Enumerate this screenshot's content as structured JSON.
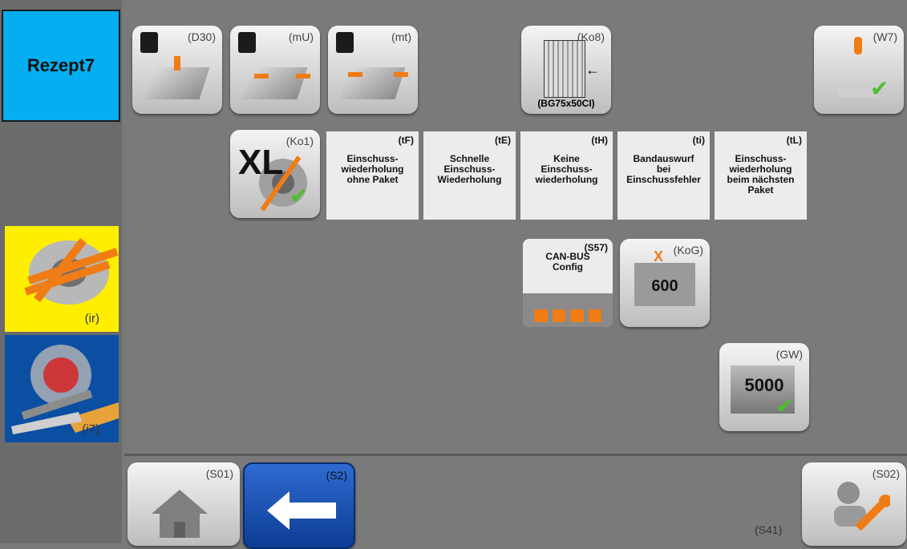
{
  "left_panel": {
    "recipe_label": "Rezept7",
    "ir_label": "(ir)",
    "i7_label": "(i7)"
  },
  "top_buttons": [
    {
      "code": "(D30)"
    },
    {
      "code": "(mU)"
    },
    {
      "code": "(mt)"
    },
    {
      "code": "(Ko8)",
      "sub": "(BG75x50CI)"
    },
    {
      "code": "(W7)"
    }
  ],
  "row2": {
    "ko1": {
      "code": "(Ko1)",
      "big": "XL"
    },
    "options": [
      {
        "code": "(tF)",
        "text": "Einschuss-\nwiederholung\nohne Paket"
      },
      {
        "code": "(tE)",
        "text": "Schnelle\nEinschuss-\nWiederholung"
      },
      {
        "code": "(tH)",
        "text": "Keine\nEinschuss-\nwiederholung"
      },
      {
        "code": "(ti)",
        "text": "Bandauswurf\nbei\nEinschussfehler"
      },
      {
        "code": "(tL)",
        "text": "Einschuss-\nwiederholung\nbeim nächsten\nPaket"
      }
    ]
  },
  "row3": {
    "s57": {
      "code": "(S57)",
      "text": "CAN-BUS\nConfig"
    },
    "kog": {
      "code": "(KoG)",
      "value": "600",
      "x": "X"
    }
  },
  "row4": {
    "gw": {
      "code": "(GW)",
      "value": "5000"
    }
  },
  "bottom": {
    "s01": "(S01)",
    "s2": "(S2)",
    "s02": "(S02)",
    "s41": "(S41)"
  }
}
